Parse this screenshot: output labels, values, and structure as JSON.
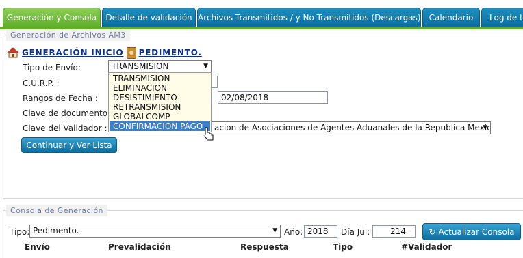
{
  "tabs": [
    {
      "label": "Generación y Consola",
      "active": true
    },
    {
      "label": "Detalle de validación",
      "active": false
    },
    {
      "label": "Archivos Transmitidos / y No Transmitidos (Descargas)",
      "active": false
    },
    {
      "label": "Calendario",
      "active": false
    },
    {
      "label": "Log de tr",
      "active": false
    }
  ],
  "generation": {
    "legend": "Generación de Archivos AM3",
    "heading_start": "GENERACIÓN INICIO",
    "heading_end": "PEDIMENTO.",
    "tipo_envio_label": "Tipo de Envío:",
    "tipo_envio_value": "TRANSMISION",
    "curp_label": "C.U.R.P. :",
    "curp_value": "",
    "rangos_label": "Rangos de Fecha :",
    "fecha_fin": "02/08/2018",
    "clave_doc_label": "Clave de documento :",
    "clave_validador_label": "Clave del Validador :",
    "clave_validador_value": "acion de Asociaciones de Agentes Aduanales de la Republica Mexicana",
    "continue_button": "Continuar y Ver Lista",
    "dropdown_options": [
      "TRANSMISION",
      "ELIMINACION",
      "DESISTIMIENTO",
      "RETRANSMISION",
      "GLOBALCOMP",
      "CONFIRMACION PAGO"
    ],
    "dropdown_selected_index": 5
  },
  "console": {
    "legend": "Consola de Generación",
    "tipo_label": "Tipo:",
    "tipo_value": "Pedimento.",
    "anio_label": "Año:",
    "anio_value": "2018",
    "dia_label": "Día Jul:",
    "dia_value": "214",
    "refresh_button": "Actualizar Consola",
    "columns": [
      "Envío",
      "Prevalidación",
      "Respuesta",
      "Tipo",
      "#Validador"
    ]
  },
  "colors": {
    "active_tab": "#5fae2b",
    "tab": "#1083b5",
    "dropdown_bg": "#fffde7",
    "selected_option": "#3a7fc9",
    "heading": "#0c2f8f"
  }
}
